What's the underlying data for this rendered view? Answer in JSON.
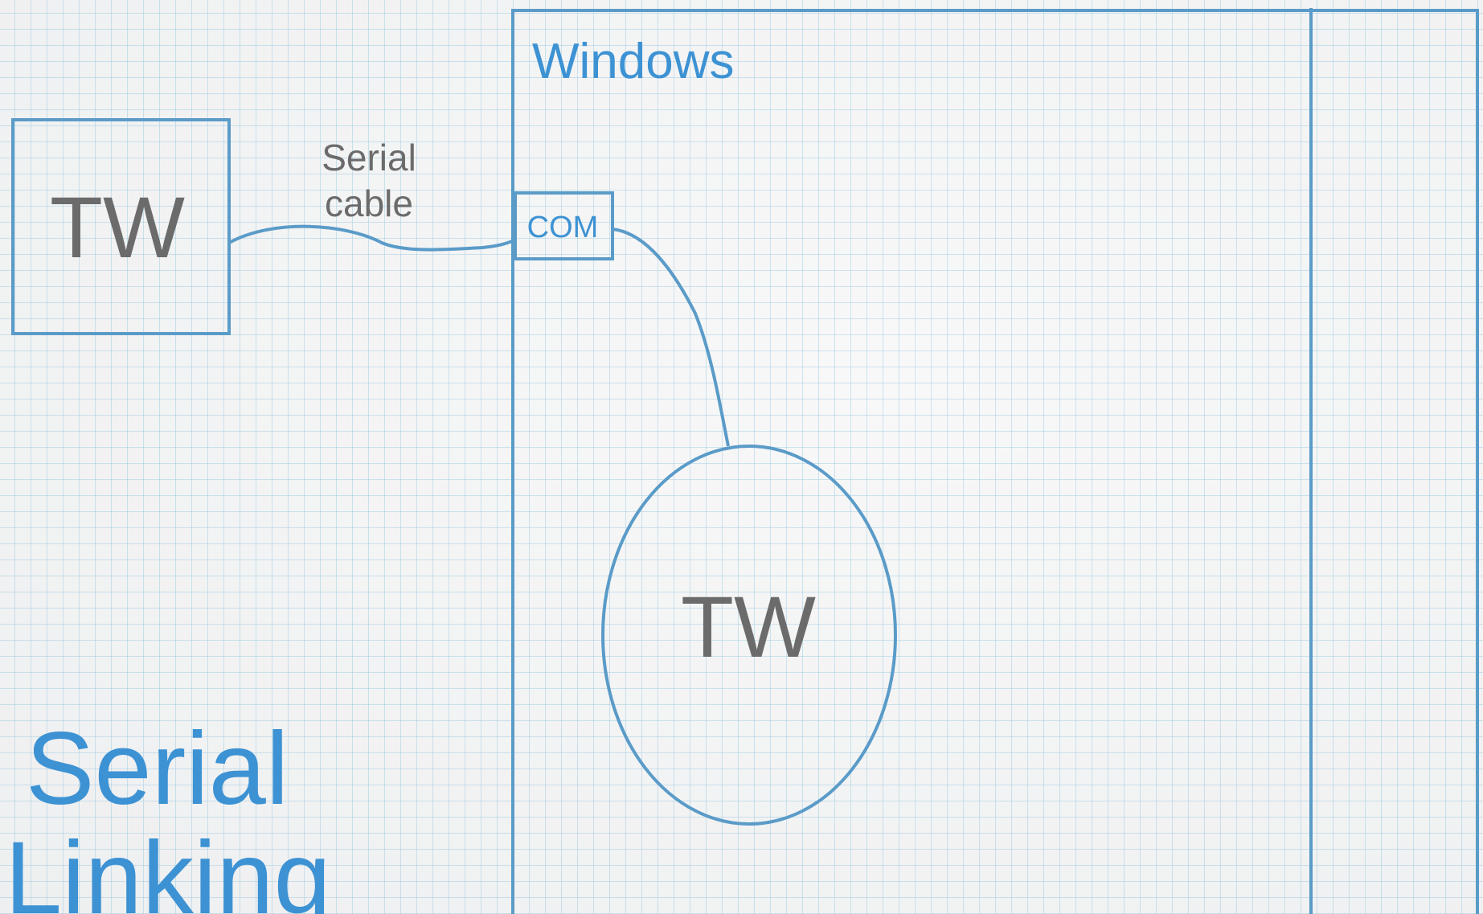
{
  "title": {
    "line1": "Serial",
    "line2": "Linking"
  },
  "external_device": {
    "label": "TW"
  },
  "cable": {
    "label_line1": "Serial",
    "label_line2": "cable"
  },
  "host": {
    "label": "Windows",
    "port_label": "COM",
    "emulator_label": "TW"
  },
  "colors": {
    "stroke": "#5a9bc8",
    "title": "#3d92d3",
    "text": "#6b6b6b",
    "grid": "#96c8e1"
  }
}
